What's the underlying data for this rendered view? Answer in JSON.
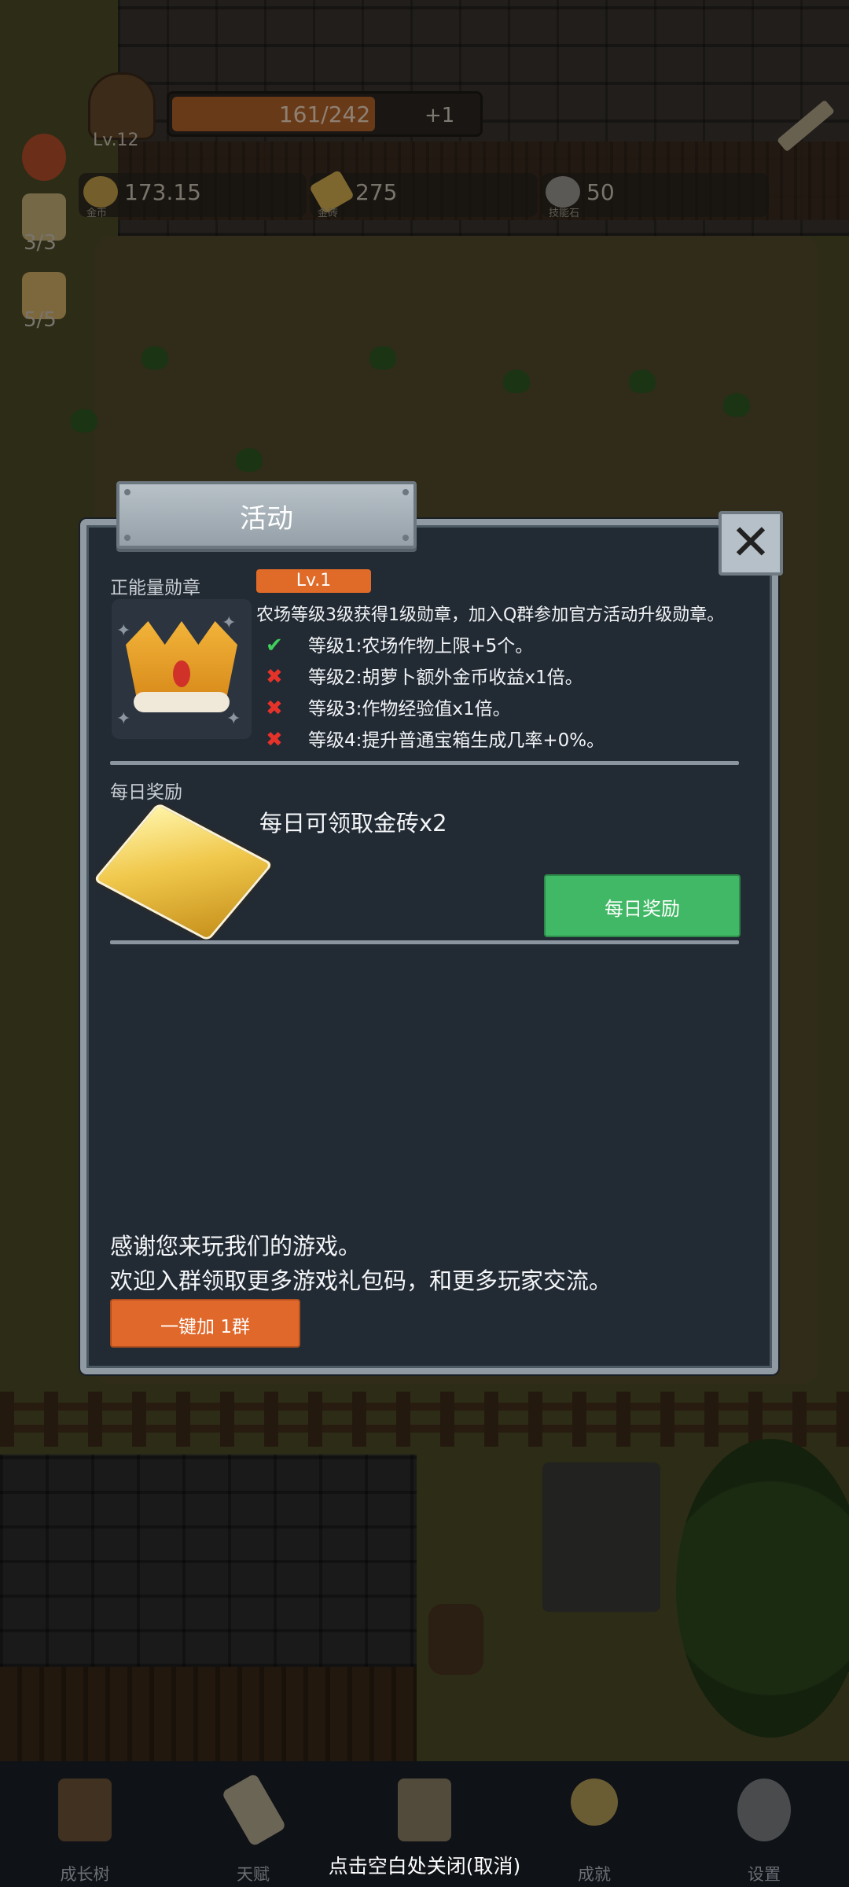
{
  "hud": {
    "level": "Lv.12",
    "xp_text": "161/242",
    "xp_progress": 0.665,
    "xp_plus": "+1",
    "resources": [
      {
        "value": "173.15",
        "label": "金币",
        "icon": "gold-coin-icon"
      },
      {
        "value": "275",
        "label": "金砖",
        "icon": "gold-brick-icon"
      },
      {
        "value": "50",
        "label": "技能石",
        "icon": "skill-stone-icon"
      }
    ],
    "side_counts": [
      "3/3",
      "5/5"
    ]
  },
  "modal": {
    "title": "活动",
    "close_symbol": "✕",
    "badge_section": {
      "label": "正能量勋章",
      "level": "Lv.1",
      "description": "农场等级3级获得1级勋章，加入Q群参加官方活动升级勋章。",
      "levels": [
        {
          "status": "ok",
          "mark": "✔",
          "text": "等级1:农场作物上限+5个。"
        },
        {
          "status": "no",
          "mark": "✖",
          "text": "等级2:胡萝卜额外金币收益x1倍。"
        },
        {
          "status": "no",
          "mark": "✖",
          "text": "等级3:作物经验值x1倍。"
        },
        {
          "status": "no",
          "mark": "✖",
          "text": "等级4:提升普通宝箱生成几率+0%。"
        }
      ]
    },
    "daily_section": {
      "label": "每日奖励",
      "text": "每日可领取金砖x2",
      "button": "每日奖励"
    },
    "thanks_line1": "感谢您来玩我们的游戏。",
    "thanks_line2": "欢迎入群领取更多游戏礼包码，和更多玩家交流。",
    "join_button": "一键加 1群"
  },
  "bottom_nav": {
    "items": [
      {
        "label": "成长树",
        "icon": "book-icon"
      },
      {
        "label": "天赋",
        "icon": "scroll-icon"
      },
      {
        "label": "",
        "icon": "map-icon"
      },
      {
        "label": "成就",
        "icon": "key-icon"
      },
      {
        "label": "设置",
        "icon": "gear-icon"
      }
    ],
    "close_hint": "点击空白处关闭(取消)"
  },
  "colors": {
    "modal_bg": "#222a34",
    "accent_orange": "#e06a28",
    "accent_green": "#41b865",
    "check_green": "#3fcf5a",
    "cross_red": "#e5332a"
  }
}
